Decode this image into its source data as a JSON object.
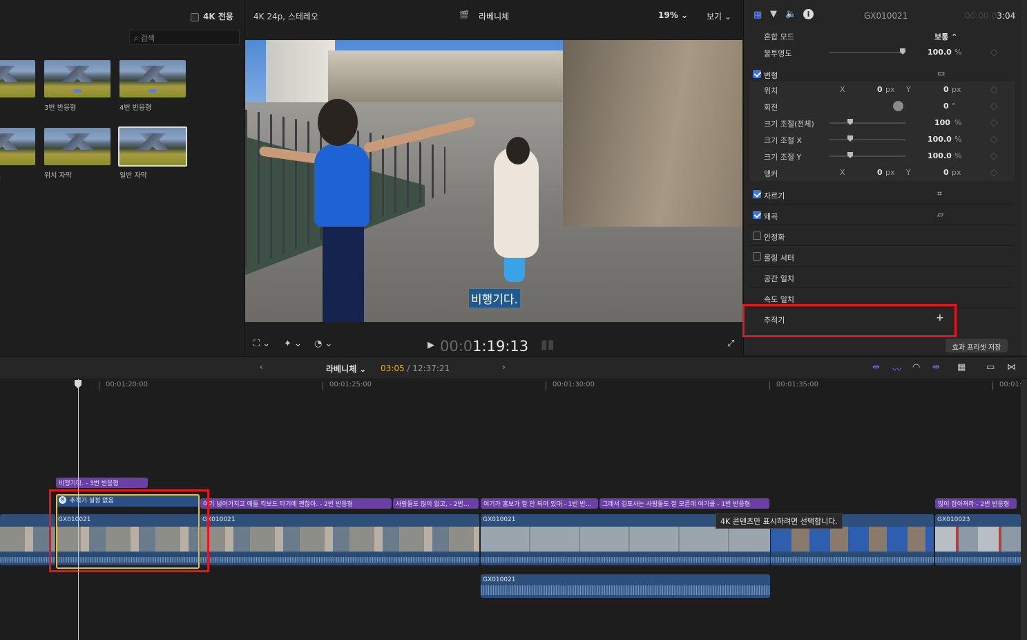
{
  "browser": {
    "k4_label": "4K 전용",
    "search_placeholder": "검색",
    "thumbnails": [
      {
        "label": "형"
      },
      {
        "label": "3번 반응형"
      },
      {
        "label": "4번 반응형"
      },
      {
        "label": "고"
      },
      {
        "label": "위치 자막"
      },
      {
        "label": "일반 자막"
      }
    ]
  },
  "viewer": {
    "format": "4K 24p, 스테레오",
    "project_name": "라베니체",
    "zoom": "19%",
    "view_menu": "보기",
    "subtitle": "비행기다.",
    "timecode_dim": "00:0",
    "timecode": "1:19:13"
  },
  "inspector": {
    "clip_name": "GX010021",
    "clip_time_dim": "00:00:0",
    "clip_time": "3:04",
    "blend_mode_label": "혼합 모드",
    "blend_mode_value": "보통 ⌃",
    "opacity_label": "불투명도",
    "opacity_value": "100.0",
    "opacity_unit": "%",
    "transform_label": "변형",
    "position_label": "위치",
    "position_x": "0",
    "position_y": "0",
    "px": "px",
    "x_axis": "X",
    "y_axis": "Y",
    "rotation_label": "회전",
    "rotation_value": "0",
    "rotation_unit": "°",
    "scale_all_label": "크기 조절(전체)",
    "scale_all_value": "100",
    "scale_x_label": "크기 조절 X",
    "scale_x_value": "100.0",
    "scale_y_label": "크기 조절 Y",
    "scale_y_value": "100.0",
    "anchor_label": "앵커",
    "anchor_x": "0",
    "anchor_y": "0",
    "pct": "%",
    "crop_label": "자르기",
    "distort_label": "왜곡",
    "stabilize_label": "안정화",
    "rolling_label": "롤링 셔터",
    "spatial_label": "공간 일치",
    "speed_label": "속도 일치",
    "tracker_label": "추적기",
    "tracker_add": "+",
    "save_preset": "효과 프리셋 저장"
  },
  "timeline_bar": {
    "project": "라베니체",
    "position": "03:05",
    "total": "/ 12:37:21"
  },
  "timeline": {
    "ruler": [
      "00:01:20:00",
      "00:01:25:00",
      "00:01:30:00",
      "00:01:35:00",
      "00:01:"
    ],
    "title_clips": [
      "비행기다. - 3번 반응형",
      "여기 넓어가지고 애들 킥보드 타기에 괜찮아. - 2번 반응형",
      "사람들도 많이 없고, - 2번…",
      "여기가 홍보가 잘 안 되어 있대 - 1번 반…",
      "그래서 김포사는 사람들도 잘 모른데 여기를 - 1번 반응형",
      "많이 잡아져라 - 2번 반응형"
    ],
    "tracker_status": "추적기 설정 없음",
    "tracker_x": "×",
    "video_clips": [
      "GX010021",
      "GX010021",
      "GX010021",
      "GX010023"
    ],
    "audio_clip": "GX010021",
    "tooltip": "4K 콘텐츠만 표시하려면 선택합니다."
  },
  "colors": {
    "highlight": "#e8141b",
    "selection": "#e6c22a",
    "accent": "#e6b020",
    "title_clip": "#6a3fa6",
    "video_clip": "#2d4f7a"
  }
}
